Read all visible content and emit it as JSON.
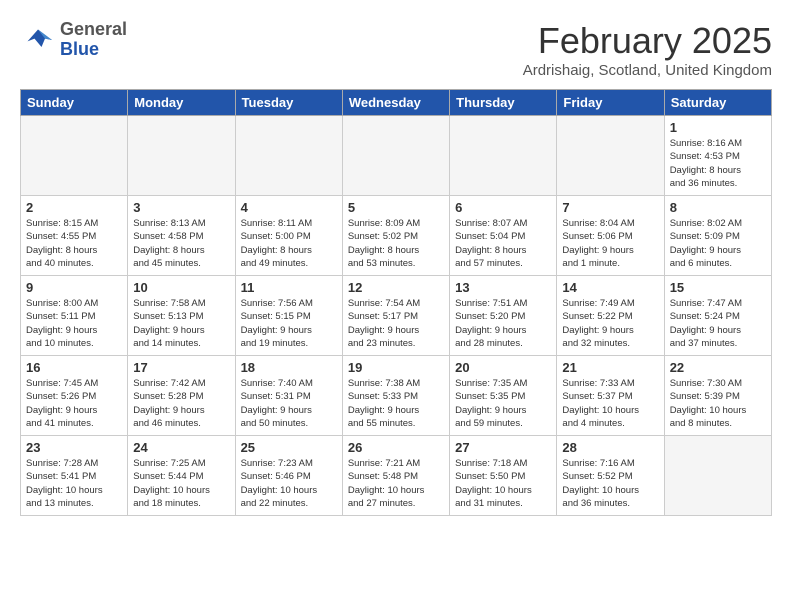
{
  "logo": {
    "line1": "General",
    "line2": "Blue"
  },
  "title": "February 2025",
  "subtitle": "Ardrishaig, Scotland, United Kingdom",
  "headers": [
    "Sunday",
    "Monday",
    "Tuesday",
    "Wednesday",
    "Thursday",
    "Friday",
    "Saturday"
  ],
  "rows": [
    [
      {
        "day": "",
        "empty": true
      },
      {
        "day": "",
        "empty": true
      },
      {
        "day": "",
        "empty": true
      },
      {
        "day": "",
        "empty": true
      },
      {
        "day": "",
        "empty": true
      },
      {
        "day": "",
        "empty": true
      },
      {
        "day": "1",
        "info": "Sunrise: 8:16 AM\nSunset: 4:53 PM\nDaylight: 8 hours\nand 36 minutes."
      }
    ],
    [
      {
        "day": "2",
        "info": "Sunrise: 8:15 AM\nSunset: 4:55 PM\nDaylight: 8 hours\nand 40 minutes."
      },
      {
        "day": "3",
        "info": "Sunrise: 8:13 AM\nSunset: 4:58 PM\nDaylight: 8 hours\nand 45 minutes."
      },
      {
        "day": "4",
        "info": "Sunrise: 8:11 AM\nSunset: 5:00 PM\nDaylight: 8 hours\nand 49 minutes."
      },
      {
        "day": "5",
        "info": "Sunrise: 8:09 AM\nSunset: 5:02 PM\nDaylight: 8 hours\nand 53 minutes."
      },
      {
        "day": "6",
        "info": "Sunrise: 8:07 AM\nSunset: 5:04 PM\nDaylight: 8 hours\nand 57 minutes."
      },
      {
        "day": "7",
        "info": "Sunrise: 8:04 AM\nSunset: 5:06 PM\nDaylight: 9 hours\nand 1 minute."
      },
      {
        "day": "8",
        "info": "Sunrise: 8:02 AM\nSunset: 5:09 PM\nDaylight: 9 hours\nand 6 minutes."
      }
    ],
    [
      {
        "day": "9",
        "info": "Sunrise: 8:00 AM\nSunset: 5:11 PM\nDaylight: 9 hours\nand 10 minutes."
      },
      {
        "day": "10",
        "info": "Sunrise: 7:58 AM\nSunset: 5:13 PM\nDaylight: 9 hours\nand 14 minutes."
      },
      {
        "day": "11",
        "info": "Sunrise: 7:56 AM\nSunset: 5:15 PM\nDaylight: 9 hours\nand 19 minutes."
      },
      {
        "day": "12",
        "info": "Sunrise: 7:54 AM\nSunset: 5:17 PM\nDaylight: 9 hours\nand 23 minutes."
      },
      {
        "day": "13",
        "info": "Sunrise: 7:51 AM\nSunset: 5:20 PM\nDaylight: 9 hours\nand 28 minutes."
      },
      {
        "day": "14",
        "info": "Sunrise: 7:49 AM\nSunset: 5:22 PM\nDaylight: 9 hours\nand 32 minutes."
      },
      {
        "day": "15",
        "info": "Sunrise: 7:47 AM\nSunset: 5:24 PM\nDaylight: 9 hours\nand 37 minutes."
      }
    ],
    [
      {
        "day": "16",
        "info": "Sunrise: 7:45 AM\nSunset: 5:26 PM\nDaylight: 9 hours\nand 41 minutes."
      },
      {
        "day": "17",
        "info": "Sunrise: 7:42 AM\nSunset: 5:28 PM\nDaylight: 9 hours\nand 46 minutes."
      },
      {
        "day": "18",
        "info": "Sunrise: 7:40 AM\nSunset: 5:31 PM\nDaylight: 9 hours\nand 50 minutes."
      },
      {
        "day": "19",
        "info": "Sunrise: 7:38 AM\nSunset: 5:33 PM\nDaylight: 9 hours\nand 55 minutes."
      },
      {
        "day": "20",
        "info": "Sunrise: 7:35 AM\nSunset: 5:35 PM\nDaylight: 9 hours\nand 59 minutes."
      },
      {
        "day": "21",
        "info": "Sunrise: 7:33 AM\nSunset: 5:37 PM\nDaylight: 10 hours\nand 4 minutes."
      },
      {
        "day": "22",
        "info": "Sunrise: 7:30 AM\nSunset: 5:39 PM\nDaylight: 10 hours\nand 8 minutes."
      }
    ],
    [
      {
        "day": "23",
        "info": "Sunrise: 7:28 AM\nSunset: 5:41 PM\nDaylight: 10 hours\nand 13 minutes."
      },
      {
        "day": "24",
        "info": "Sunrise: 7:25 AM\nSunset: 5:44 PM\nDaylight: 10 hours\nand 18 minutes."
      },
      {
        "day": "25",
        "info": "Sunrise: 7:23 AM\nSunset: 5:46 PM\nDaylight: 10 hours\nand 22 minutes."
      },
      {
        "day": "26",
        "info": "Sunrise: 7:21 AM\nSunset: 5:48 PM\nDaylight: 10 hours\nand 27 minutes."
      },
      {
        "day": "27",
        "info": "Sunrise: 7:18 AM\nSunset: 5:50 PM\nDaylight: 10 hours\nand 31 minutes."
      },
      {
        "day": "28",
        "info": "Sunrise: 7:16 AM\nSunset: 5:52 PM\nDaylight: 10 hours\nand 36 minutes."
      },
      {
        "day": "",
        "empty": true
      }
    ]
  ]
}
